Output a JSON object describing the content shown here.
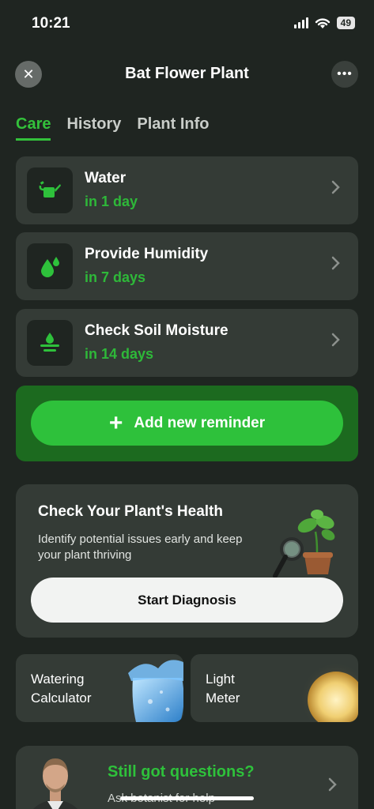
{
  "status": {
    "time": "10:21",
    "battery": "49"
  },
  "header": {
    "title": "Bat Flower Plant",
    "close_icon": "close-icon",
    "more_icon": "more-horizontal-icon"
  },
  "tabs": [
    {
      "label": "Care",
      "active": true
    },
    {
      "label": "History",
      "active": false
    },
    {
      "label": "Plant Info",
      "active": false
    }
  ],
  "tasks": [
    {
      "title": "Water",
      "due": "in 1 day",
      "icon": "watering-can-icon"
    },
    {
      "title": "Provide Humidity",
      "due": "in 7 days",
      "icon": "water-drops-icon"
    },
    {
      "title": "Check Soil Moisture",
      "due": "in 14 days",
      "icon": "soil-moisture-icon"
    }
  ],
  "add_reminder": {
    "label": "Add new reminder"
  },
  "health": {
    "title": "Check Your Plant's Health",
    "description": "Identify potential issues early and keep your plant thriving",
    "button": "Start Diagnosis"
  },
  "tools": [
    {
      "line1": "Watering",
      "line2": "Calculator"
    },
    {
      "line1": "Light",
      "line2": "Meter"
    }
  ],
  "ask": {
    "title": "Still got questions?",
    "subtitle": "Ask botanist for help"
  },
  "colors": {
    "accent": "#2ec13b",
    "background": "#1f2521",
    "card": "#343b36"
  }
}
